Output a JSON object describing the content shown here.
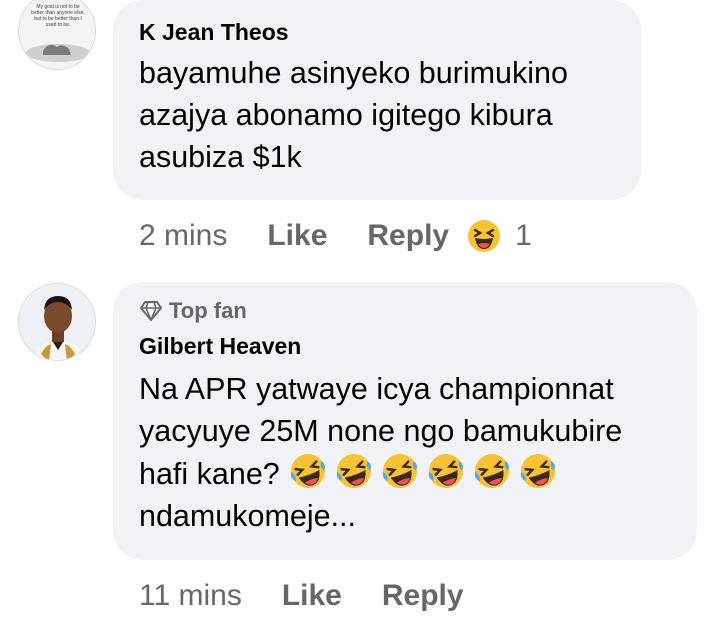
{
  "comments": [
    {
      "author": "K Jean Theos",
      "text": "bayamuhe asinyeko burimukino azajya abonamo igitego kibura asubiza $1k",
      "time": "2 mins",
      "like_label": "Like",
      "reply_label": "Reply",
      "reaction_count": "1",
      "avatar_text": "My goal is not to be better than anyone else, but to be better than I used to be."
    },
    {
      "badge": "Top fan",
      "author": "Gilbert Heaven",
      "text": "Na APR yatwaye icya championnat yacyuye 25M none ngo bamukubire hafi kane?",
      "text_end": "ndamukomeje...",
      "time": "11 mins",
      "like_label": "Like",
      "reply_label": "Reply"
    }
  ],
  "colors": {
    "bubble": "#f0f2f5",
    "secondary_text": "#65676b",
    "primary_text": "#050505",
    "emoji_yellow": "#f7c236"
  },
  "icons": [
    "grinning-squinting-emoji-icon",
    "rolling-on-floor-laughing-emoji-icon",
    "diamond-icon"
  ]
}
